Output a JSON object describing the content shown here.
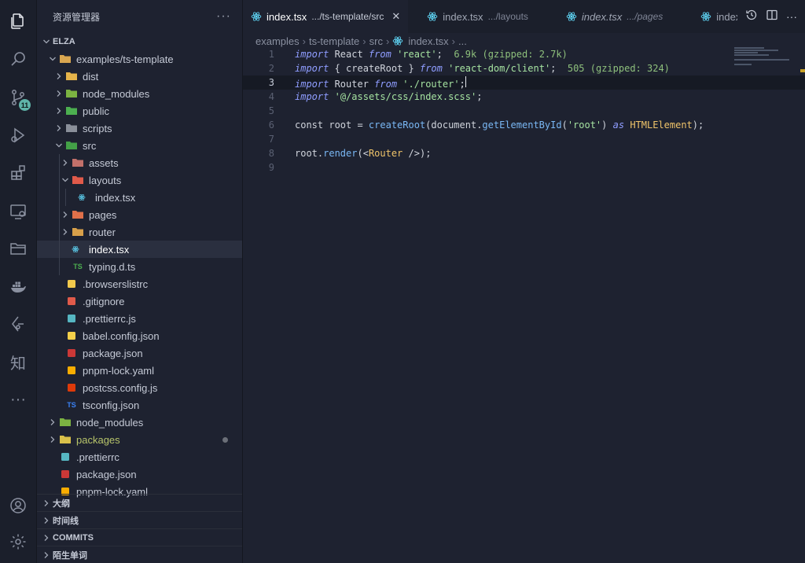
{
  "activity_bar": {
    "items": [
      {
        "icon": "files-icon",
        "active": true
      },
      {
        "icon": "search-icon"
      },
      {
        "icon": "source-control-icon",
        "badge": "11"
      },
      {
        "icon": "run-debug-icon"
      },
      {
        "icon": "extensions-icon"
      },
      {
        "icon": "remote-explorer-icon"
      },
      {
        "icon": "folder-icon"
      },
      {
        "icon": "docker-icon"
      },
      {
        "icon": "gitlens-icon"
      },
      {
        "icon": "zhihu-icon",
        "glyph": "知"
      },
      {
        "icon": "more-icon",
        "glyph": "···"
      }
    ],
    "bottom": [
      {
        "icon": "account-icon"
      },
      {
        "icon": "settings-gear-icon"
      }
    ]
  },
  "explorer": {
    "title": "资源管理器",
    "more": "···",
    "root": "ELZA",
    "tree": [
      {
        "label": "examples/ts-template",
        "depth": 1,
        "kind": "folder-open",
        "icon_color": "#d9a650"
      },
      {
        "label": "dist",
        "depth": 2,
        "kind": "folder",
        "icon_color": "#e6b44a"
      },
      {
        "label": "node_modules",
        "depth": 2,
        "kind": "folder",
        "icon_color": "#7cb342"
      },
      {
        "label": "public",
        "depth": 2,
        "kind": "folder",
        "icon_color": "#4caf50"
      },
      {
        "label": "scripts",
        "depth": 2,
        "kind": "folder",
        "icon_color": "#8a8f9a"
      },
      {
        "label": "src",
        "depth": 2,
        "kind": "folder-open",
        "icon_color": "#43a047"
      },
      {
        "label": "assets",
        "depth": 3,
        "kind": "folder",
        "icon_color": "#c2706a"
      },
      {
        "label": "layouts",
        "depth": 3,
        "kind": "folder-open",
        "icon_color": "#e05a4a"
      },
      {
        "label": "index.tsx",
        "depth": 4,
        "kind": "react"
      },
      {
        "label": "pages",
        "depth": 3,
        "kind": "folder",
        "icon_color": "#e0704a"
      },
      {
        "label": "router",
        "depth": 3,
        "kind": "folder",
        "icon_color": "#d8a04a"
      },
      {
        "label": "index.tsx",
        "depth": 3,
        "kind": "react",
        "selected": true
      },
      {
        "label": "typing.d.ts",
        "depth": 3,
        "kind": "ts-def"
      },
      {
        "label": ".browserslistrc",
        "depth": 2,
        "kind": "file",
        "icon_color": "#f2c94c"
      },
      {
        "label": ".gitignore",
        "depth": 2,
        "kind": "file",
        "icon_color": "#e05a4a"
      },
      {
        "label": ".prettierrc.js",
        "depth": 2,
        "kind": "file",
        "icon_color": "#56b6c2"
      },
      {
        "label": "babel.config.json",
        "depth": 2,
        "kind": "file",
        "icon_color": "#f5d04a"
      },
      {
        "label": "package.json",
        "depth": 2,
        "kind": "file",
        "icon_color": "#cb3837"
      },
      {
        "label": "pnpm-lock.yaml",
        "depth": 2,
        "kind": "file",
        "icon_color": "#f9ad00"
      },
      {
        "label": "postcss.config.js",
        "depth": 2,
        "kind": "file",
        "icon_color": "#dd3a0a"
      },
      {
        "label": "tsconfig.json",
        "depth": 2,
        "kind": "ts",
        "icon_color": "#3b82f6"
      },
      {
        "label": "node_modules",
        "depth": 1,
        "kind": "folder",
        "icon_color": "#7cb342"
      },
      {
        "label": "packages",
        "depth": 1,
        "kind": "folder",
        "icon_color": "#d9c04a",
        "modified": true
      },
      {
        "label": ".prettierrc",
        "depth": 1,
        "kind": "file",
        "icon_color": "#56b6c2"
      },
      {
        "label": "package.json",
        "depth": 1,
        "kind": "file",
        "icon_color": "#cb3837"
      },
      {
        "label": "pnpm-lock.yaml",
        "depth": 1,
        "kind": "file",
        "icon_color": "#f9ad00"
      }
    ],
    "panels": [
      "大纲",
      "时间线",
      "COMMITS",
      "陌生单词"
    ]
  },
  "tabs": [
    {
      "name": "index.tsx",
      "dir": ".../ts-template/src",
      "active": true,
      "close": "✕"
    },
    {
      "name": "index.tsx",
      "dir": ".../layouts"
    },
    {
      "name": "index.tsx",
      "dir": ".../pages",
      "italic": true
    },
    {
      "name": "index",
      "dir": ""
    }
  ],
  "breadcrumb": [
    "examples",
    "ts-template",
    "src",
    "index.tsx",
    "..."
  ],
  "code": {
    "current_line": 3,
    "lines": [
      {
        "n": "1",
        "tokens": [
          [
            "kw",
            "import"
          ],
          [
            "id",
            " React "
          ],
          [
            "kw",
            "from"
          ],
          [
            "id",
            " "
          ],
          [
            "str",
            "'react'"
          ],
          [
            "id",
            ";"
          ],
          [
            "hint",
            "  6.9k (gzipped: 2.7k)"
          ]
        ]
      },
      {
        "n": "2",
        "tokens": [
          [
            "kw",
            "import"
          ],
          [
            "id",
            " { "
          ],
          [
            "id",
            "createRoot"
          ],
          [
            "id",
            " } "
          ],
          [
            "kw",
            "from"
          ],
          [
            "id",
            " "
          ],
          [
            "str",
            "'react-dom/client'"
          ],
          [
            "id",
            ";"
          ],
          [
            "hint",
            "  505 (gzipped: 324)"
          ]
        ]
      },
      {
        "n": "3",
        "tokens": [
          [
            "kw",
            "import"
          ],
          [
            "id",
            " Router "
          ],
          [
            "kw",
            "from"
          ],
          [
            "id",
            " "
          ],
          [
            "str",
            "'./router'"
          ],
          [
            "id",
            ";"
          ]
        ]
      },
      {
        "n": "4",
        "tokens": [
          [
            "kw",
            "import"
          ],
          [
            "id",
            " "
          ],
          [
            "str",
            "'@/assets/css/index.scss'"
          ],
          [
            "id",
            ";"
          ]
        ]
      },
      {
        "n": "5",
        "tokens": []
      },
      {
        "n": "6",
        "tokens": [
          [
            "id",
            "const root = "
          ],
          [
            "fn",
            "createRoot"
          ],
          [
            "id",
            "(document."
          ],
          [
            "fn",
            "getElementById"
          ],
          [
            "id",
            "("
          ],
          [
            "str",
            "'root'"
          ],
          [
            "id",
            ") "
          ],
          [
            "kw",
            "as"
          ],
          [
            "id",
            " "
          ],
          [
            "ty",
            "HTMLElement"
          ],
          [
            "id",
            ");"
          ]
        ]
      },
      {
        "n": "7",
        "tokens": []
      },
      {
        "n": "8",
        "tokens": [
          [
            "id",
            "root."
          ],
          [
            "fn",
            "render"
          ],
          [
            "id",
            "(<"
          ],
          [
            "ty",
            "Router"
          ],
          [
            "id",
            " />);"
          ]
        ]
      },
      {
        "n": "9",
        "tokens": []
      }
    ]
  }
}
